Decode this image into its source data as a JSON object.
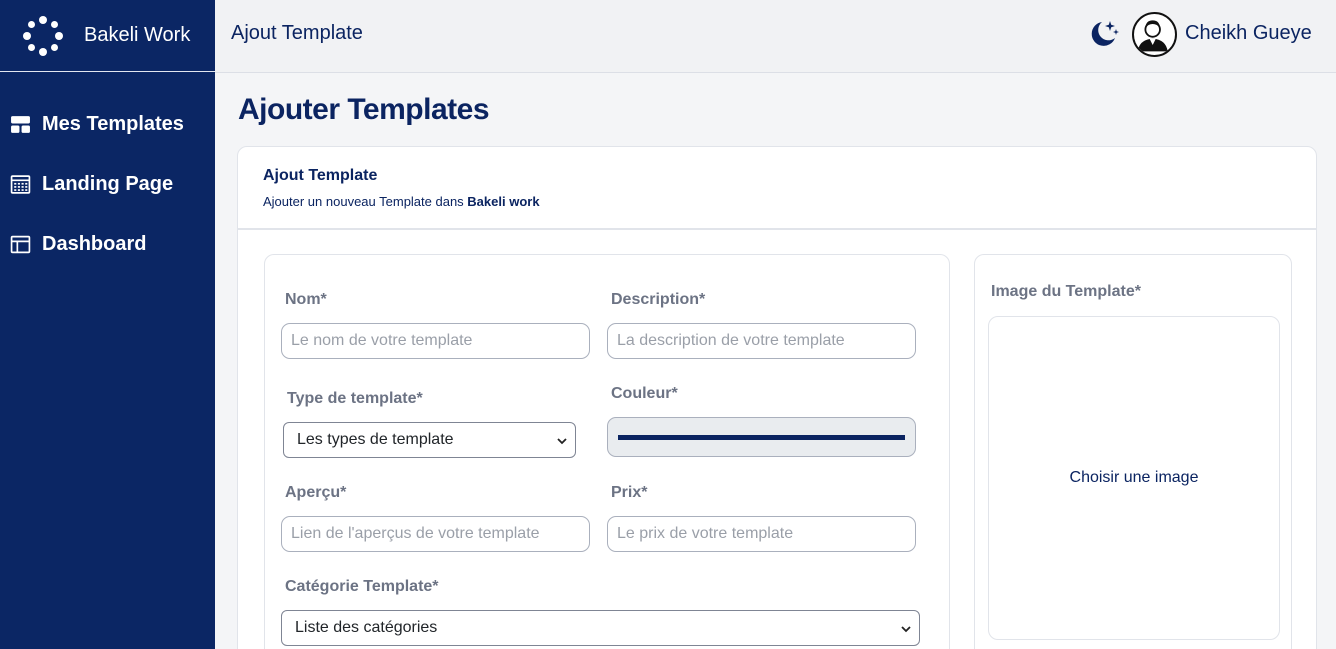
{
  "brand": {
    "name": "Bakeli Work",
    "logo_icon": "spinner-dots-icon"
  },
  "sidebar": {
    "items": [
      {
        "label": "Mes Templates",
        "icon": "layout-grid-icon"
      },
      {
        "label": "Landing Page",
        "icon": "landing-page-icon"
      },
      {
        "label": "Dashboard",
        "icon": "dashboard-layout-icon"
      }
    ]
  },
  "header": {
    "title": "Ajout Template",
    "theme_icon": "moon-stars-icon",
    "user_name": "Cheikh Gueye"
  },
  "page": {
    "title": "Ajouter Templates"
  },
  "card": {
    "title": "Ajout Template",
    "subtitle_prefix": "Ajouter un nouveau Template dans ",
    "subtitle_brand": "Bakeli work"
  },
  "form": {
    "nom": {
      "label": "Nom*",
      "placeholder": "Le nom de votre template",
      "value": ""
    },
    "description": {
      "label": "Description*",
      "placeholder": "La description de votre template",
      "value": ""
    },
    "type": {
      "label": "Type de template*",
      "selected": "Les types de template"
    },
    "couleur": {
      "label": "Couleur*",
      "value": "#0b2461"
    },
    "apercu": {
      "label": "Aperçu*",
      "placeholder": "Lien de l'aperçus de votre template",
      "value": ""
    },
    "prix": {
      "label": "Prix*",
      "placeholder": "Le prix de votre template",
      "value": ""
    },
    "categorie": {
      "label": "Catégorie Template*",
      "selected": "Liste des catégories"
    }
  },
  "image_panel": {
    "label": "Image du Template*",
    "choose_label": "Choisir une image"
  },
  "colors": {
    "sidebar_bg": "#0b2664",
    "primary_text": "#0b2461",
    "label_gray": "#6c7384",
    "topbar_bg": "#f1f2f4"
  }
}
